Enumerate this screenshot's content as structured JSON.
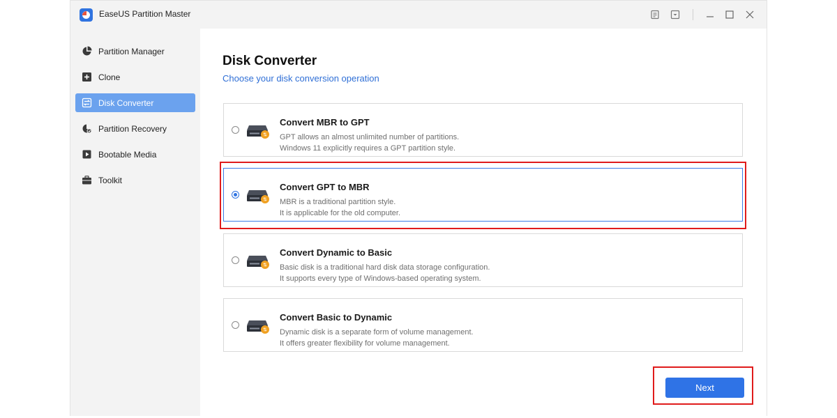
{
  "app": {
    "title": "EaseUS Partition Master",
    "icons": [
      "app-logo-icon",
      "feedback-icon",
      "download-icon",
      "minimize-icon",
      "maximize-icon",
      "close-icon"
    ]
  },
  "sidebar": {
    "items": [
      {
        "label": "Partition Manager",
        "icon": "pie-chart-icon",
        "active": false
      },
      {
        "label": "Clone",
        "icon": "clone-icon",
        "active": false
      },
      {
        "label": "Disk Converter",
        "icon": "disk-converter-icon",
        "active": true
      },
      {
        "label": "Partition Recovery",
        "icon": "partition-recovery-icon",
        "active": false
      },
      {
        "label": "Bootable Media",
        "icon": "bootable-media-icon",
        "active": false
      },
      {
        "label": "Toolkit",
        "icon": "toolkit-icon",
        "active": false
      }
    ]
  },
  "main": {
    "title": "Disk Converter",
    "subtitle": "Choose your disk conversion operation",
    "options": [
      {
        "title": "Convert MBR to GPT",
        "line1": "GPT allows an almost unlimited number of partitions.",
        "line2": "Windows 11 explicitly requires a GPT partition style.",
        "selected": false
      },
      {
        "title": "Convert GPT to MBR",
        "line1": "MBR is a traditional partition style.",
        "line2": "It is applicable for the old computer.",
        "selected": true
      },
      {
        "title": "Convert Dynamic to Basic",
        "line1": "Basic disk is a traditional hard disk data storage configuration.",
        "line2": "It supports every type of Windows-based operating system.",
        "selected": false
      },
      {
        "title": "Convert Basic to Dynamic",
        "line1": "Dynamic disk is a separate form of volume management.",
        "line2": "It offers greater flexibility for volume management.",
        "selected": false
      }
    ],
    "next_label": "Next"
  },
  "colors": {
    "accent": "#2f73e6",
    "sidebar_active": "#6ba2ee",
    "highlight": "#e01b1b"
  }
}
